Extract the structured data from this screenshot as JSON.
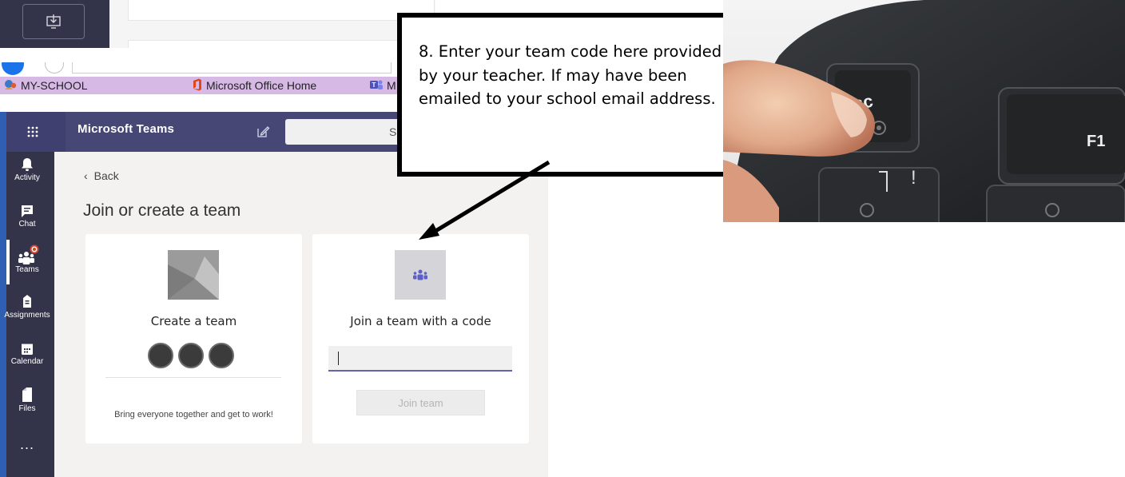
{
  "callout": {
    "text": "8. Enter your team code here provided by your teacher. If may have been emailed to your school email address."
  },
  "browser": {
    "bookmarks": [
      {
        "label": "MY-SCHOOL",
        "icon": "school-favicon"
      },
      {
        "label": "Microsoft Office Home",
        "icon": "office-icon"
      },
      {
        "label": "M",
        "icon": "teams-favicon"
      }
    ]
  },
  "teams": {
    "app_title": "Microsoft Teams",
    "search_placeholder": "S",
    "rail": [
      {
        "label": "Activity",
        "icon": "bell-icon"
      },
      {
        "label": "Chat",
        "icon": "chat-icon"
      },
      {
        "label": "Teams",
        "icon": "teams-icon",
        "active": true
      },
      {
        "label": "Assignments",
        "icon": "assignments-icon"
      },
      {
        "label": "Calendar",
        "icon": "calendar-icon"
      },
      {
        "label": "Files",
        "icon": "files-icon"
      },
      {
        "label": "...",
        "icon": "more-icon"
      }
    ],
    "back_label": "Back",
    "page_title": "Join or create a team",
    "create_card": {
      "title": "Create a team",
      "tagline": "Bring everyone together and get to work!"
    },
    "join_card": {
      "title": "Join a team with a code",
      "input_value": "",
      "button_label": "Join team"
    },
    "colors": {
      "brand": "#464775",
      "rail": "#33344a",
      "accent": "#6264a7",
      "badge": "#cc4a31"
    }
  },
  "photo": {
    "key_labels": [
      "Esc",
      "F1"
    ]
  }
}
